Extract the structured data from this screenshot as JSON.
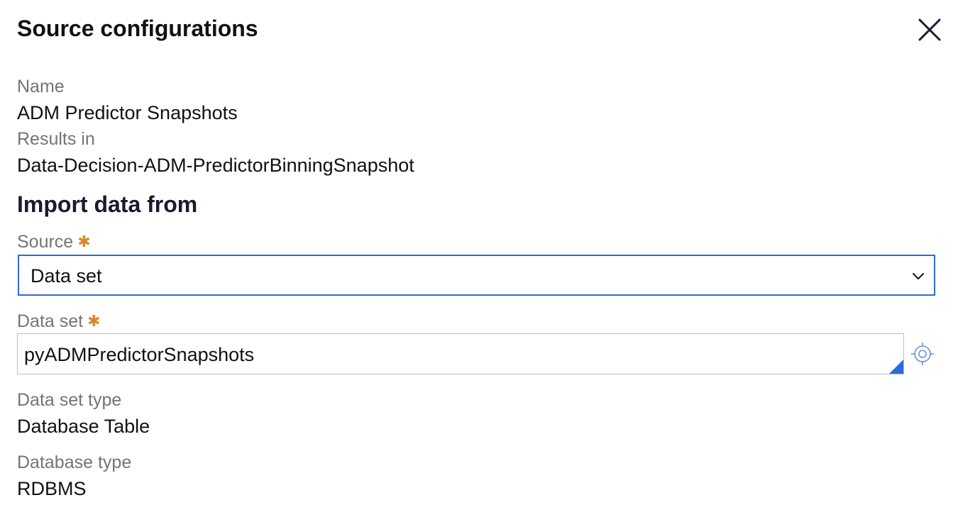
{
  "dialog": {
    "title": "Source configurations",
    "close_icon": "close-icon"
  },
  "details": {
    "name_label": "Name",
    "name_value": "ADM Predictor Snapshots",
    "results_label": "Results in",
    "results_value": "Data-Decision-ADM-PredictorBinningSnapshot"
  },
  "import": {
    "heading": "Import data from",
    "source_label": "Source",
    "source_value": "Data set",
    "dataset_label": "Data set",
    "dataset_value": "pyADMPredictorSnapshots",
    "dataset_type_label": "Data set type",
    "dataset_type_value": "Database Table",
    "database_type_label": "Database type",
    "database_type_value": "RDBMS",
    "required_marker": "✱"
  },
  "colors": {
    "accent": "#2e6bd9",
    "required": "#d9892a",
    "muted_label": "#747474"
  },
  "icons": {
    "select": "chevron-down-icon",
    "lookup": "crosshair-target-icon"
  }
}
